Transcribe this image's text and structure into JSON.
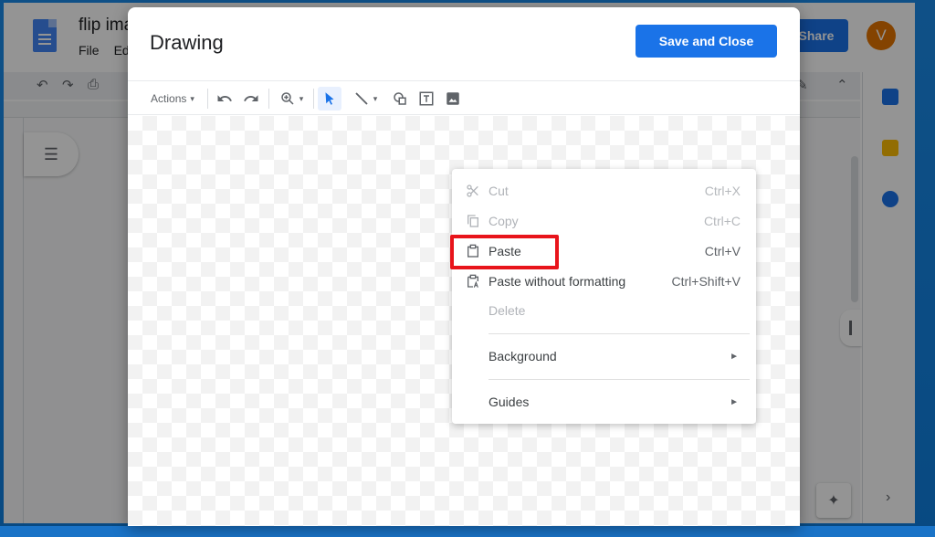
{
  "docs": {
    "title": "flip ima",
    "menu": [
      "File",
      "Ed"
    ],
    "share_label": "Share",
    "avatar_initial": "V"
  },
  "dialog": {
    "title": "Drawing",
    "save_label": "Save and Close"
  },
  "toolbar": {
    "actions_label": "Actions",
    "tools": [
      {
        "name": "undo-icon"
      },
      {
        "name": "redo-icon"
      },
      {
        "name": "zoom-icon"
      },
      {
        "name": "select-icon"
      },
      {
        "name": "line-icon"
      },
      {
        "name": "shape-icon"
      },
      {
        "name": "textbox-icon"
      },
      {
        "name": "image-icon"
      }
    ]
  },
  "context_menu": {
    "items": [
      {
        "label": "Cut",
        "shortcut": "Ctrl+X",
        "icon": "scissors-icon",
        "enabled": false
      },
      {
        "label": "Copy",
        "shortcut": "Ctrl+C",
        "icon": "copy-icon",
        "enabled": false
      },
      {
        "label": "Paste",
        "shortcut": "Ctrl+V",
        "icon": "clipboard-icon",
        "enabled": true,
        "highlighted": true
      },
      {
        "label": "Paste without formatting",
        "shortcut": "Ctrl+Shift+V",
        "icon": "clipboard-text-icon",
        "enabled": true
      },
      {
        "label": "Delete",
        "shortcut": "",
        "enabled": false
      },
      {
        "label": "Background",
        "submenu": true,
        "enabled": true
      },
      {
        "label": "Guides",
        "submenu": true,
        "enabled": true
      }
    ]
  },
  "colors": {
    "accent": "#1a73e8",
    "highlight": "#e8141b",
    "avatar": "#e37400"
  }
}
